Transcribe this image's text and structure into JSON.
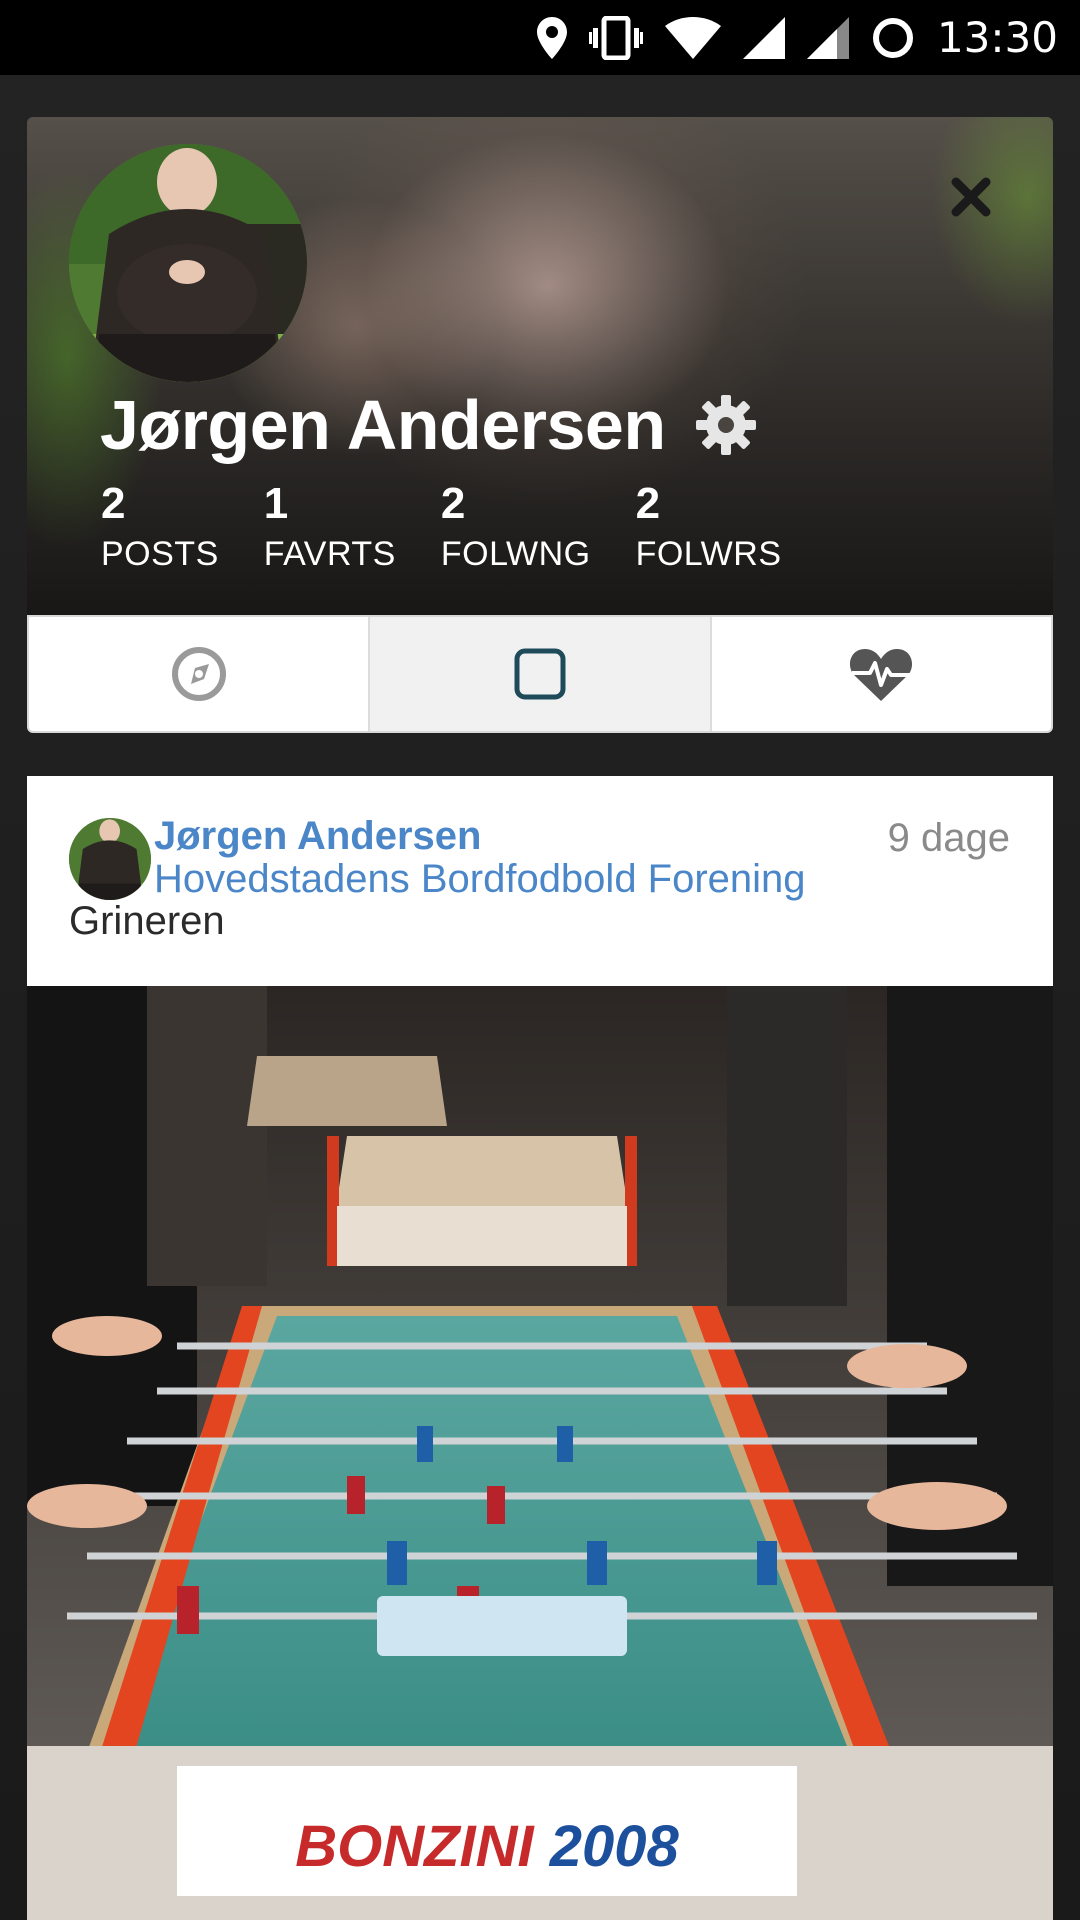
{
  "status_bar": {
    "time": "13:30",
    "icons": [
      "location-icon",
      "vibrate-icon",
      "wifi-icon",
      "signal-icon",
      "signal-2-icon",
      "sync-icon"
    ]
  },
  "profile": {
    "name": "Jørgen Andersen",
    "stats": [
      {
        "value": "2",
        "label": "POSTS"
      },
      {
        "value": "1",
        "label": "FAVRTS"
      },
      {
        "value": "2",
        "label": "FOLWNG"
      },
      {
        "value": "2",
        "label": "FOLWRS"
      }
    ]
  },
  "tabs": [
    {
      "icon": "compass-icon",
      "active": false
    },
    {
      "icon": "square-icon",
      "active": true
    },
    {
      "icon": "heartbeat-icon",
      "active": false
    }
  ],
  "post": {
    "author": "Jørgen Andersen",
    "group": "Hovedstadens Bordfodbold Forening",
    "text": "Grineren",
    "age": "9 dage",
    "image_caption_text": "BONZINI 2008"
  },
  "colors": {
    "link": "#4a86c8",
    "tab_icon": "#9a9a9a",
    "active_tab_icon": "#1f4a5a"
  }
}
